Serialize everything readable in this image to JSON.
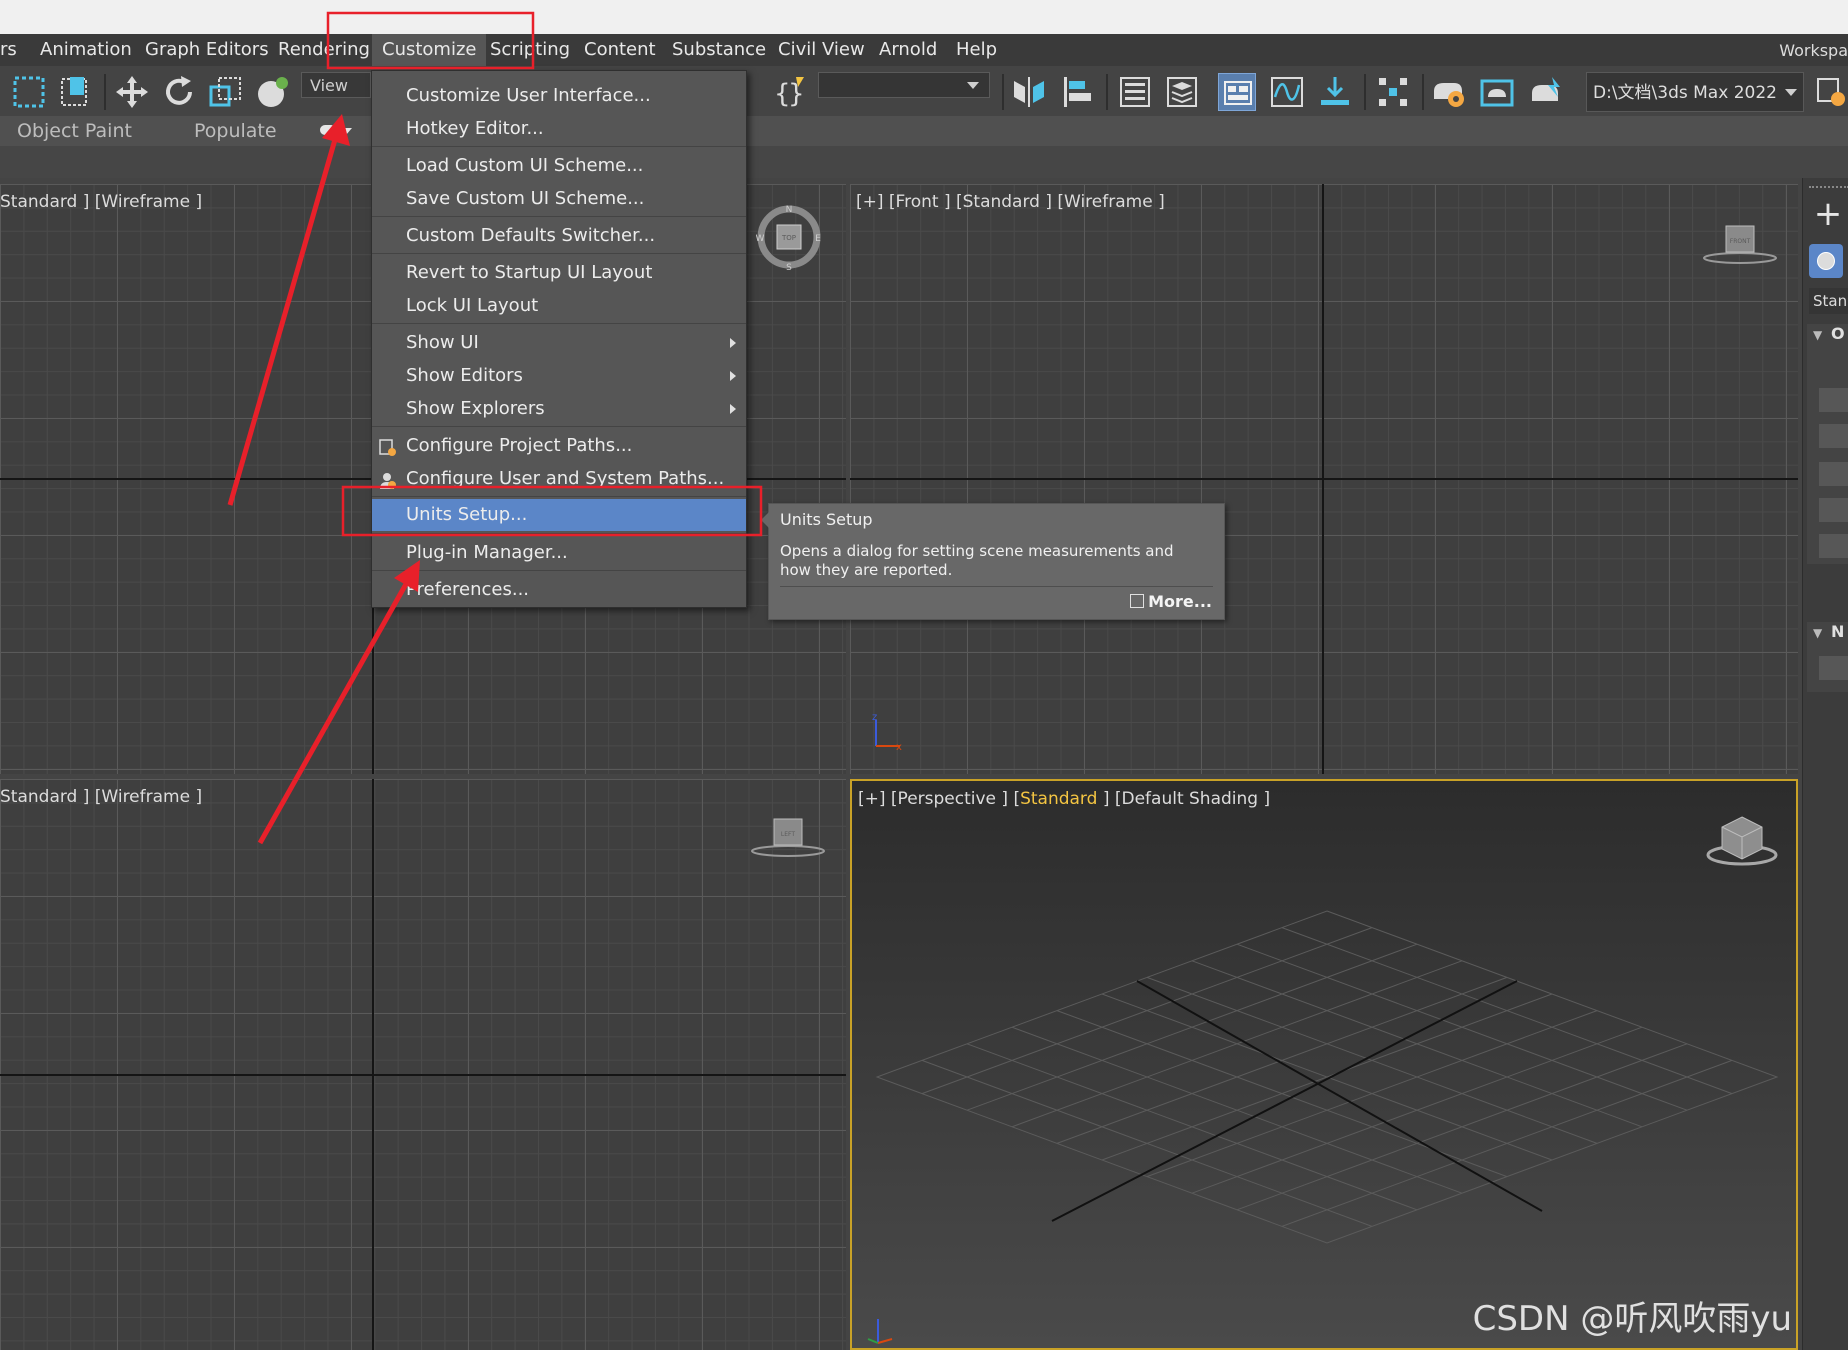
{
  "menubar": {
    "items": [
      "rs",
      "Animation",
      "Graph Editors",
      "Rendering",
      "Customize",
      "Scripting",
      "Content",
      "Substance",
      "Civil View",
      "Arnold",
      "Help"
    ],
    "active": "Customize",
    "workspace_label": "Workspa"
  },
  "toolbar": {
    "view_dropdown": "View",
    "path_dropdown": "D:\\文档\\3ds Max 2022",
    "icons": [
      "select-region-icon",
      "window-crossing-icon",
      "move-icon",
      "rotate-icon",
      "scale-icon",
      "select-manipulate-icon",
      "curly-braces-icon",
      "mirror-icon",
      "align-icon",
      "scene-explorer-icon",
      "layer-explorer-icon",
      "toggle-ribbon-icon",
      "curve-editor-icon",
      "schematic-view-icon",
      "material-editor-icon",
      "render-setup-icon",
      "rendered-frame-window-icon",
      "render-icon"
    ]
  },
  "ribbon": {
    "tabs": [
      "Object Paint",
      "Populate"
    ]
  },
  "viewports": {
    "top_label": "Standard ] [Wireframe ]",
    "front_label": "[+] [Front ] [Standard ] [Wireframe ]",
    "left_label": "Standard ] [Wireframe ]",
    "perspective_label_prefix": "[+] [Perspective ] [",
    "perspective_label_standard": "Standard",
    "perspective_label_suffix": " ] [Default Shading ]",
    "viewcube_top": "TOP",
    "viewcube_front": "FRONT",
    "viewcube_left": "LEFT",
    "compass": {
      "n": "N",
      "s": "S",
      "e": "E",
      "w": "W"
    }
  },
  "customize_menu": {
    "items": [
      "Customize User Interface...",
      "Hotkey Editor...",
      "Load Custom UI Scheme...",
      "Save Custom UI Scheme...",
      "Custom Defaults Switcher...",
      "Revert to Startup UI Layout",
      "Lock UI Layout",
      "Show UI",
      "Show Editors",
      "Show Explorers",
      "Configure Project Paths...",
      "Configure User and System Paths...",
      "Units Setup...",
      "Plug-in Manager...",
      "Preferences..."
    ],
    "selected": "Units Setup..."
  },
  "tooltip": {
    "title": "Units Setup",
    "description": "Opens a dialog for setting scene measurements and how they are reported.",
    "more_link": "More..."
  },
  "command_panel": {
    "dropdown_text": "Stan",
    "rollout_labels": [
      "O",
      "N"
    ]
  },
  "watermark": "CSDN @听风吹雨yu",
  "colors": {
    "annotation_red": "#e8202a",
    "selection_blue": "#5b86c8",
    "highlight_yellow": "#f4c542",
    "perspective_border": "#c9a227"
  }
}
